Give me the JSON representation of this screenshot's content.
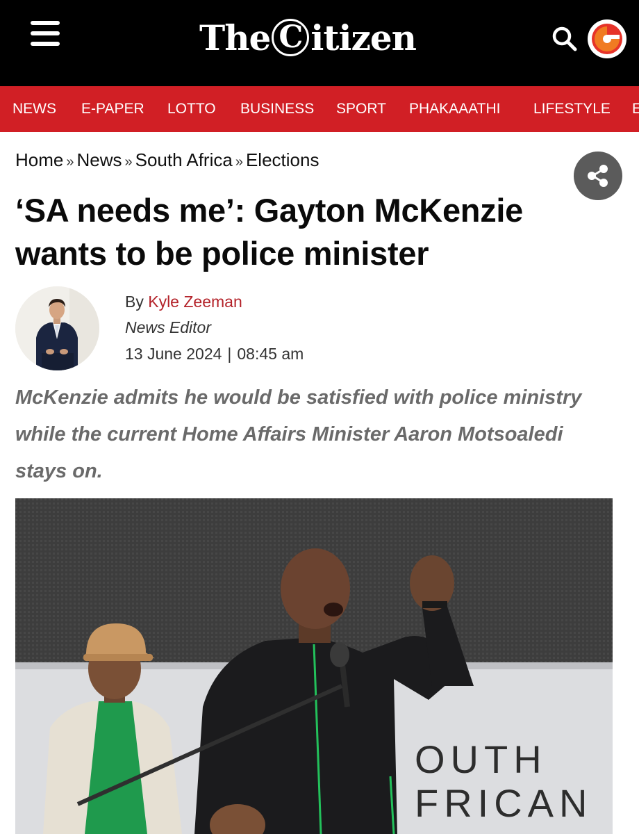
{
  "header": {
    "logo_pre": "The",
    "logo_c": "C",
    "logo_post": "itizen",
    "menu_icon": "hamburger-icon",
    "search_icon": "search-icon",
    "badge_icon": "citizen-c-logo-icon",
    "background": "#000000"
  },
  "nav": {
    "background": "#d11f25",
    "items": [
      "NEWS",
      "E-PAPER",
      "LOTTO",
      "BUSINESS",
      "SPORT",
      "PHAKAAATHI",
      "LIFESTYLE",
      "E"
    ]
  },
  "breadcrumb": {
    "items": [
      "Home",
      "News",
      "South Africa",
      "Elections"
    ],
    "separator": "»"
  },
  "share_icon": "share-icon",
  "article": {
    "headline": "‘SA needs me’: Gayton McKenzie wants to be police minister",
    "by_prefix": "By",
    "author_name": "Kyle Zeeman",
    "author_role": "News Editor",
    "date": "13 June 2024",
    "date_separator": "|",
    "time": "08:45 am",
    "standfirst": "McKenzie admits he would be satisfied with police ministry while the current Home Affairs Minister Aaron Motsoaledi stays on.",
    "accent_color": "#b4232a"
  },
  "lead_image": {
    "backdrop_lines": [
      "OUTH",
      "FRICAN"
    ]
  }
}
